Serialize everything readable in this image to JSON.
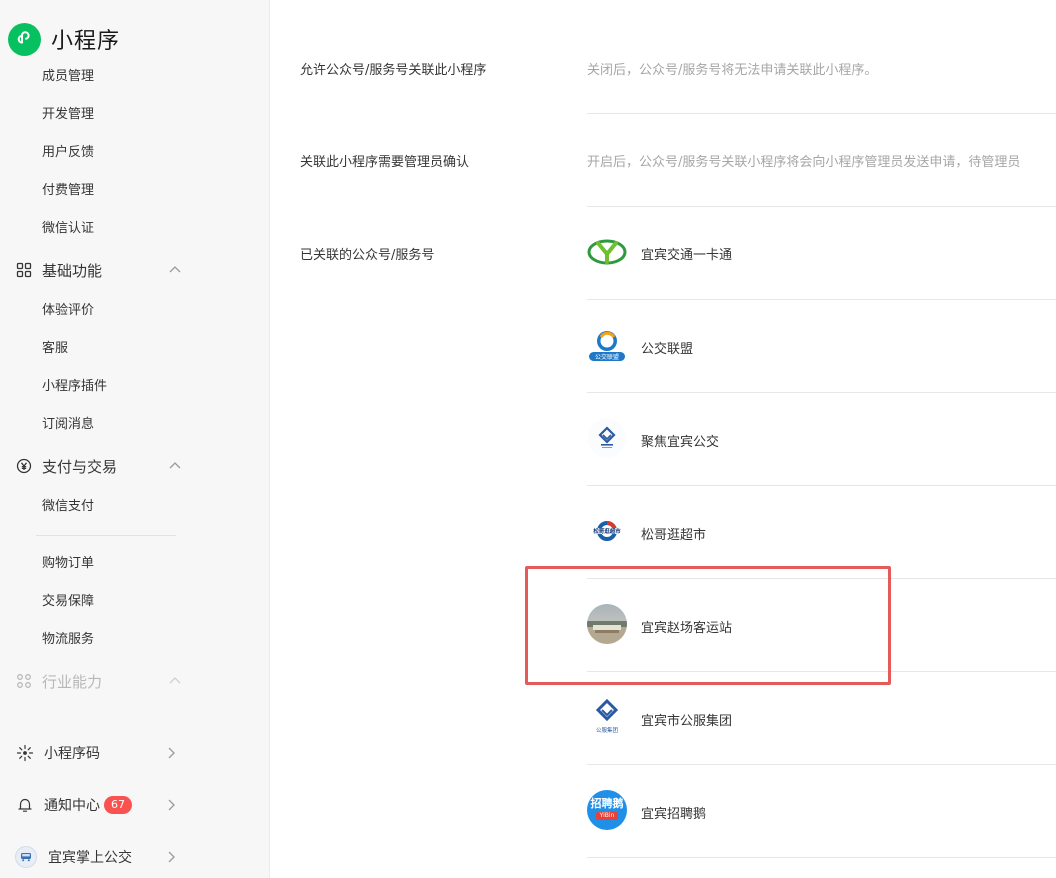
{
  "sidebar": {
    "brand": "小程序",
    "top_items": [
      "成员管理",
      "开发管理",
      "用户反馈",
      "付费管理",
      "微信认证"
    ],
    "groups": {
      "basic": {
        "label": "基础功能",
        "items": [
          "体验评价",
          "客服",
          "小程序插件",
          "订阅消息"
        ]
      },
      "pay": {
        "label": "支付与交易",
        "items": [
          "微信支付",
          "购物订单",
          "交易保障",
          "物流服务"
        ]
      },
      "industry": {
        "label": "行业能力"
      }
    },
    "bottom": {
      "qrcode": "小程序码",
      "notify": "通知中心",
      "notify_count": "67",
      "account": "宜宾掌上公交"
    }
  },
  "settings": {
    "allow_link": {
      "label": "允许公众号/服务号关联此小程序",
      "desc": "关闭后，公众号/服务号将无法申请关联此小程序。"
    },
    "need_confirm": {
      "label": "关联此小程序需要管理员确认",
      "desc": "开启后，公众号/服务号关联小程序将会向小程序管理员发送申请，待管理员"
    },
    "linked": {
      "label": "已关联的公众号/服务号",
      "accounts": [
        {
          "name": "宜宾交通一卡通"
        },
        {
          "name": "公交联盟",
          "logo_text": "公交联盟"
        },
        {
          "name": "聚焦宜宾公交"
        },
        {
          "name": "松哥逛超市",
          "logo_text": "松哥逛超市"
        },
        {
          "name": "宜宾赵场客运站"
        },
        {
          "name": "宜宾市公服集团",
          "logo_text": "公服集团"
        },
        {
          "name": "宜宾招聘鹅",
          "logo_text": "招聘鹅",
          "logo_sub": "YiBin"
        }
      ]
    }
  },
  "colors": {
    "accent": "#07c160",
    "badge": "#fa5151",
    "highlight": "#e75a5a"
  }
}
